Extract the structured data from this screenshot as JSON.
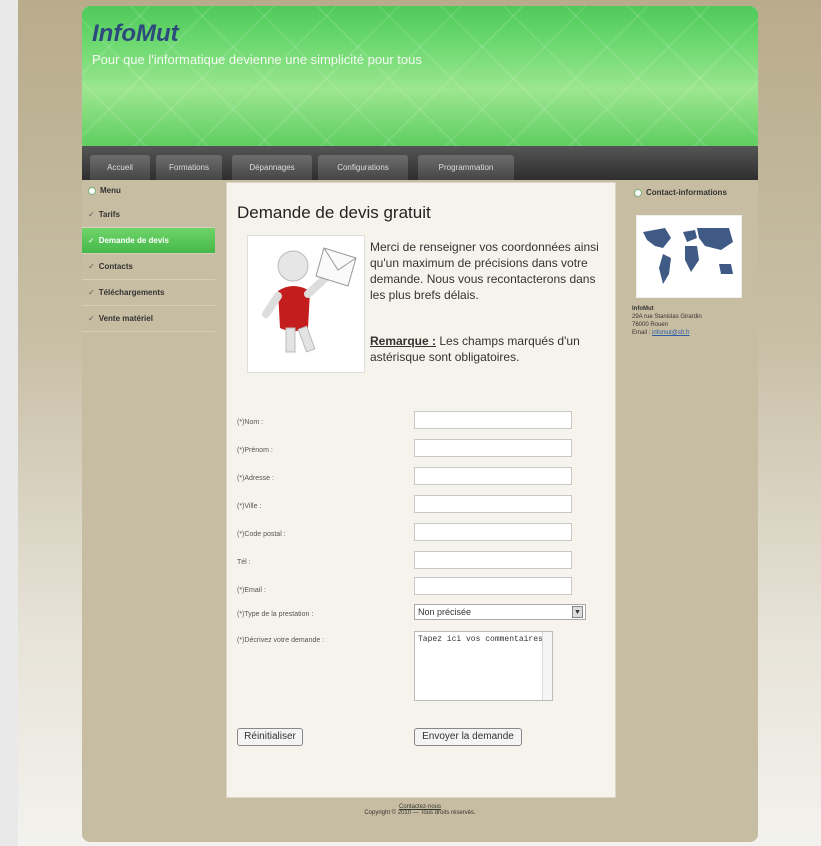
{
  "site": {
    "title": "InfoMut",
    "slogan": "Pour que l'informatique devienne une simplicité pour tous"
  },
  "nav": {
    "items": [
      {
        "label": "Accueil"
      },
      {
        "label": "Formations"
      },
      {
        "label": "Dépannages"
      },
      {
        "label": "Configurations"
      },
      {
        "label": "Programmation"
      }
    ]
  },
  "sidebar": {
    "menu_label": "Menu",
    "items": [
      {
        "label": "Tarifs"
      },
      {
        "label": "Demande de devis",
        "active": true
      },
      {
        "label": "Contacts"
      },
      {
        "label": "Téléchargements"
      },
      {
        "label": "Vente matériel"
      }
    ]
  },
  "content": {
    "title": "Demande de devis gratuit",
    "intro": "Merci de renseigner vos coordonnées ainsi qu'un maximum de précisions dans votre demande. Nous vous recontacterons dans les plus brefs délais.",
    "remark_label": "Remarque :",
    "remark_text": "Les champs marqués d'un astérisque sont obligatoires."
  },
  "form": {
    "nom_label": "(*)Nom :",
    "prenom_label": "(*)Prénom :",
    "adresse_label": "(*)Adresse :",
    "ville_label": "(*)Ville :",
    "code_postal_label": "(*)Code postal :",
    "tel_label": "Tél :",
    "email_label": "(*)Email :",
    "type_label": "(*)Type de la prestation :",
    "type_value": "Non précisée",
    "demande_label": "(*)Décrivez votre demande :",
    "demande_value": "Tapez ici vos commentaires",
    "reset_label": "Réinitialiser",
    "submit_label": "Envoyer la demande"
  },
  "contact": {
    "heading": "Contact-informations",
    "name": "InfoMut",
    "address1": "29A rue Stanislas Girardin",
    "address2": "76000 Rouen",
    "email_prefix": "Email :",
    "email": "infomut@sfr.fr"
  },
  "footer": {
    "link": "Contactez-nous",
    "copyright": "Copyright © 2010 — Tous droits réservés."
  }
}
